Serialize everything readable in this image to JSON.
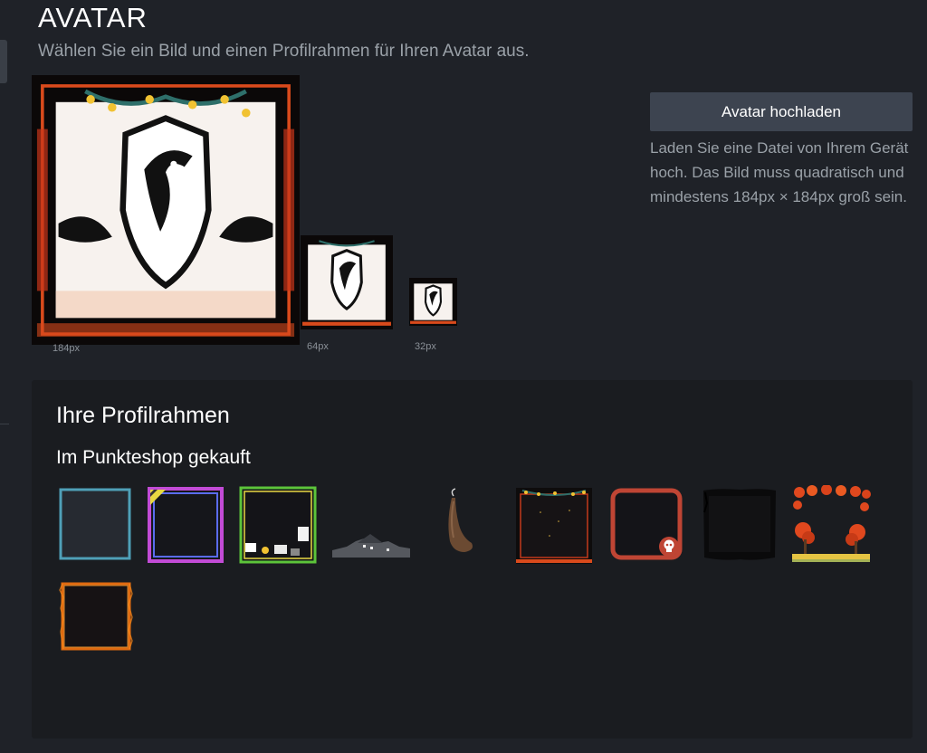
{
  "header": {
    "title": "AVATAR",
    "subtitle": "Wählen Sie ein Bild und einen Profilrahmen für Ihren Avatar aus."
  },
  "avatar_preview": {
    "sizes": [
      {
        "label": "184px",
        "name": "avatar-preview-large"
      },
      {
        "label": "64px",
        "name": "avatar-preview-medium"
      },
      {
        "label": "32px",
        "name": "avatar-preview-small"
      }
    ]
  },
  "upload": {
    "button_label": "Avatar hochladen",
    "hint": "Laden Sie eine Datei von Ihrem Gerät hoch. Das Bild muss quadratisch und mindestens 184px × 184px groß sein."
  },
  "frames": {
    "title": "Ihre Profilrahmen",
    "section_title": "Im Punkteshop gekauft",
    "items": [
      {
        "name": "frame-option-1",
        "icon": "plain-teal-frame"
      },
      {
        "name": "frame-option-2",
        "icon": "neon-purple-frame"
      },
      {
        "name": "frame-option-3",
        "icon": "green-comic-frame"
      },
      {
        "name": "frame-option-4",
        "icon": "gray-rooftop-frame"
      },
      {
        "name": "frame-option-5",
        "icon": "brown-tail-frame"
      },
      {
        "name": "frame-option-6",
        "icon": "starry-ornament-frame"
      },
      {
        "name": "frame-option-7",
        "icon": "red-skull-frame"
      },
      {
        "name": "frame-option-8",
        "icon": "dark-ink-frame"
      },
      {
        "name": "frame-option-9",
        "icon": "autumn-trees-frame"
      },
      {
        "name": "frame-option-10",
        "icon": "fire-frame"
      }
    ]
  },
  "colors": {
    "background": "#1f2228",
    "panel": "#1a1c20",
    "button": "#3d4450",
    "muted_text": "#9aa1a8"
  }
}
